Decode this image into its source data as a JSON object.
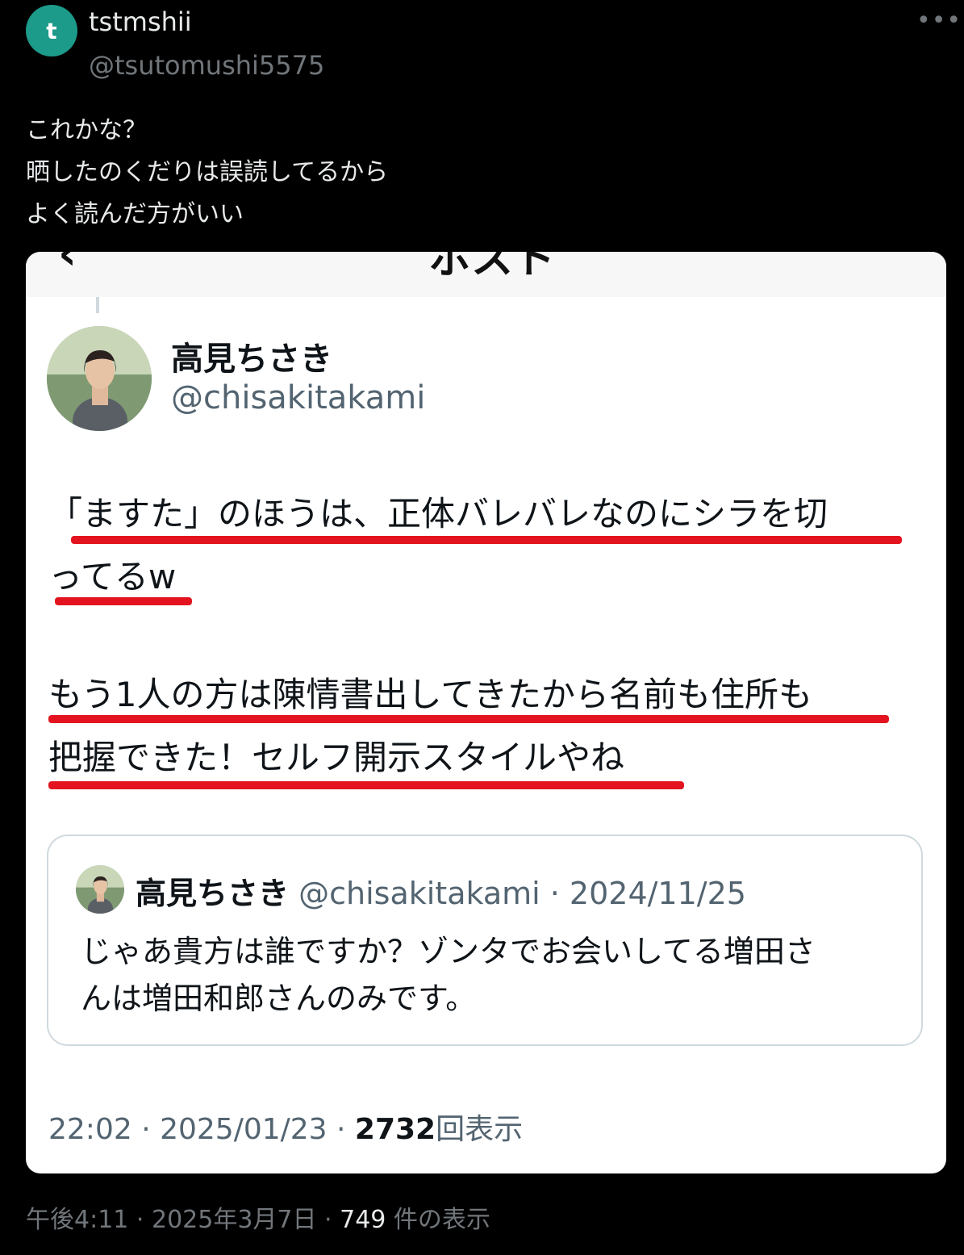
{
  "post": {
    "avatar_letter": "t",
    "author_name": "tstmshii",
    "author_handle": "@tsutomushi5575",
    "more_icon": "more-options-icon",
    "text_lines": [
      "これかな？",
      "晒したのくだりは誤読してるから",
      "よく読んだ方がいい"
    ],
    "footer": {
      "time_date": "午後4:11 · 2025年3月7日 · ",
      "views_count": "749",
      "views_label": " 件の表示"
    }
  },
  "screenshot": {
    "topbar_back_icon": "back-arrow-icon",
    "topbar_title": "ポスト",
    "author_name": "高見ちさき",
    "author_handle": "@chisakitakami",
    "body_lines": [
      "「ますた」のほうは、正体バレバレなのにシラを切",
      "ってるw",
      "もう1人の方は陳情書出してきたから名前も住所も",
      "把握できた！セルフ開示スタイルやね"
    ],
    "highlight_color": "#e3141f",
    "quoted": {
      "author_name": "高見ちさき",
      "meta": "@chisakitakami · 2024/11/25",
      "text_lines": [
        "じゃあ貴方は誰ですか？ゾンタでお会いしてる増田さ",
        "んは増田和郎さんのみです。"
      ]
    },
    "footer": {
      "time_date": "22:02 · 2025/01/23 · ",
      "views_count": "2732",
      "views_label": "回表示"
    }
  }
}
